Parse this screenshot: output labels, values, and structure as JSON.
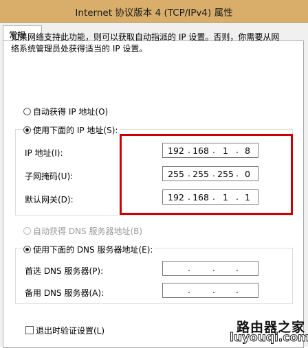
{
  "window": {
    "title": "Internet 协议版本 4 (TCP/IPv4) 属性"
  },
  "tabs": [
    {
      "label": "常规"
    }
  ],
  "intro": {
    "line1": "如果网络支持此功能，则可以获取自动指派的 IP 设置。否则，你需要从网",
    "line2": "络系统管理员处获得适当的 IP 设置。"
  },
  "ip": {
    "auto_label": "自动获得 IP 地址(O)",
    "manual_label": "使用下面的 IP 地址(S):",
    "selected": "manual",
    "fields": [
      {
        "label": "IP 地址(I):",
        "octets": [
          "192",
          "168",
          "1",
          "8"
        ]
      },
      {
        "label": "子网掩码(U):",
        "octets": [
          "255",
          "255",
          "255",
          "0"
        ]
      },
      {
        "label": "默认网关(D):",
        "octets": [
          "192",
          "168",
          "1",
          "1"
        ]
      }
    ]
  },
  "dns": {
    "auto_label": "自动获得 DNS 服务器地址(B)",
    "manual_label": "使用下面的 DNS 服务器地址(E):",
    "selected": "manual",
    "fields": [
      {
        "label": "首选 DNS 服务器(P):",
        "octets": [
          "",
          "",
          "",
          ""
        ]
      },
      {
        "label": "备用 DNS 服务器(A):",
        "octets": [
          "",
          "",
          "",
          ""
        ]
      }
    ]
  },
  "validate": {
    "label": "退出时验证设置(L)",
    "checked": false
  },
  "watermark": {
    "line1": "路由器之家",
    "line2": "luyouqi.com"
  },
  "colors": {
    "titlebar": "#d9ae6a",
    "highlight": "#cc0000"
  }
}
